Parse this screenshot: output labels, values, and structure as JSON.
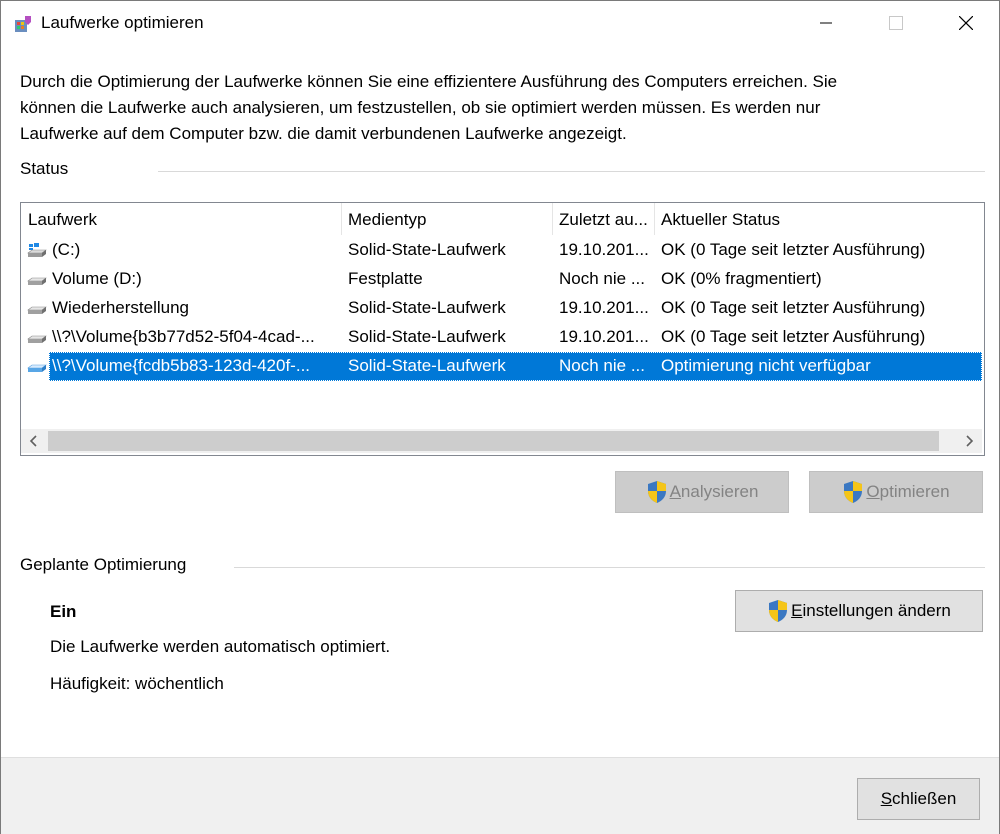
{
  "window": {
    "title": "Laufwerke optimieren",
    "description": "Durch die Optimierung der Laufwerke können Sie eine effizientere Ausführung des Computers erreichen. Sie können die Laufwerke auch analysieren, um festzustellen, ob sie optimiert werden müssen. Es werden nur Laufwerke auf dem Computer bzw. die damit verbundenen Laufwerke angezeigt."
  },
  "status": {
    "label": "Status",
    "columns": [
      "Laufwerk",
      "Medientyp",
      "Zuletzt au...",
      "Aktueller Status"
    ],
    "rows": [
      {
        "drive": "(C:)",
        "media": "Solid-State-Laufwerk",
        "last": "19.10.201...",
        "status": "OK (0 Tage seit letzter Ausführung)",
        "icon": "windows-drive-icon"
      },
      {
        "drive": "Volume (D:)",
        "media": "Festplatte",
        "last": "Noch nie ...",
        "status": "OK (0% fragmentiert)",
        "icon": "hard-drive-icon"
      },
      {
        "drive": "Wiederherstellung",
        "media": "Solid-State-Laufwerk",
        "last": "19.10.201...",
        "status": "OK (0 Tage seit letzter Ausführung)",
        "icon": "hard-drive-icon"
      },
      {
        "drive": "\\\\?\\Volume{b3b77d52-5f04-4cad-...",
        "media": "Solid-State-Laufwerk",
        "last": "19.10.201...",
        "status": "OK (0 Tage seit letzter Ausführung)",
        "icon": "hard-drive-icon"
      },
      {
        "drive": "\\\\?\\Volume{fcdb5b83-123d-420f-...",
        "media": "Solid-State-Laufwerk",
        "last": "Noch nie ...",
        "status": "Optimierung nicht verfügbar",
        "icon": "hard-drive-icon",
        "selected": true
      }
    ]
  },
  "actions": {
    "analyze_first": "A",
    "analyze_rest": "nalysieren",
    "optimize_first": "O",
    "optimize_rest": "ptimieren"
  },
  "schedule": {
    "label": "Geplante Optimierung",
    "state": "Ein",
    "info": "Die Laufwerke werden automatisch optimiert.",
    "frequency": "Häufigkeit: wöchentlich",
    "settings_first": "E",
    "settings_rest": "instellungen ändern"
  },
  "footer": {
    "close_first": "S",
    "close_rest": "chließen"
  },
  "colors": {
    "selection": "#0078d7",
    "disabled_button": "#cccccc",
    "footer_bg": "#f0f0f0"
  }
}
